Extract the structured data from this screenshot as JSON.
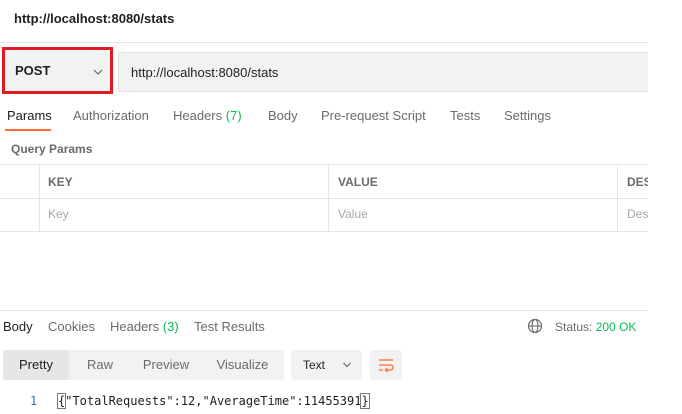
{
  "tab": {
    "title": "http://localhost:8080/stats"
  },
  "request": {
    "method": "POST",
    "url": "http://localhost:8080/stats",
    "highlight_color": "#e01b24"
  },
  "request_tabs": [
    {
      "label": "Params",
      "active": true
    },
    {
      "label": "Authorization",
      "active": false
    },
    {
      "label": "Headers",
      "count": "(7)",
      "active": false
    },
    {
      "label": "Body",
      "active": false
    },
    {
      "label": "Pre-request Script",
      "active": false
    },
    {
      "label": "Tests",
      "active": false
    },
    {
      "label": "Settings",
      "active": false
    }
  ],
  "query_params": {
    "title": "Query Params",
    "columns": [
      "KEY",
      "VALUE",
      "DES"
    ],
    "placeholders": [
      "Key",
      "Value",
      "Des"
    ]
  },
  "response_tabs": [
    {
      "label": "Body",
      "active": true
    },
    {
      "label": "Cookies",
      "active": false
    },
    {
      "label": "Headers",
      "count": "(3)",
      "active": false
    },
    {
      "label": "Test Results",
      "active": false
    }
  ],
  "status": {
    "label": "Status:",
    "value": "200 OK",
    "icon": "globe-icon"
  },
  "format_buttons": [
    {
      "label": "Pretty",
      "active": true
    },
    {
      "label": "Raw",
      "active": false
    },
    {
      "label": "Preview",
      "active": false
    },
    {
      "label": "Visualize",
      "active": false
    }
  ],
  "language": {
    "selected": "Text"
  },
  "wrap_icon": "wrap-lines-icon",
  "response_body": {
    "line_number": "1",
    "open_brace": "{",
    "content": "\"TotalRequests\":12,\"AverageTime\":11455391",
    "close_brace": "}"
  },
  "colors": {
    "accent": "#ff6c37",
    "success": "#0cbb52",
    "line_number": "#2c6ed5"
  }
}
